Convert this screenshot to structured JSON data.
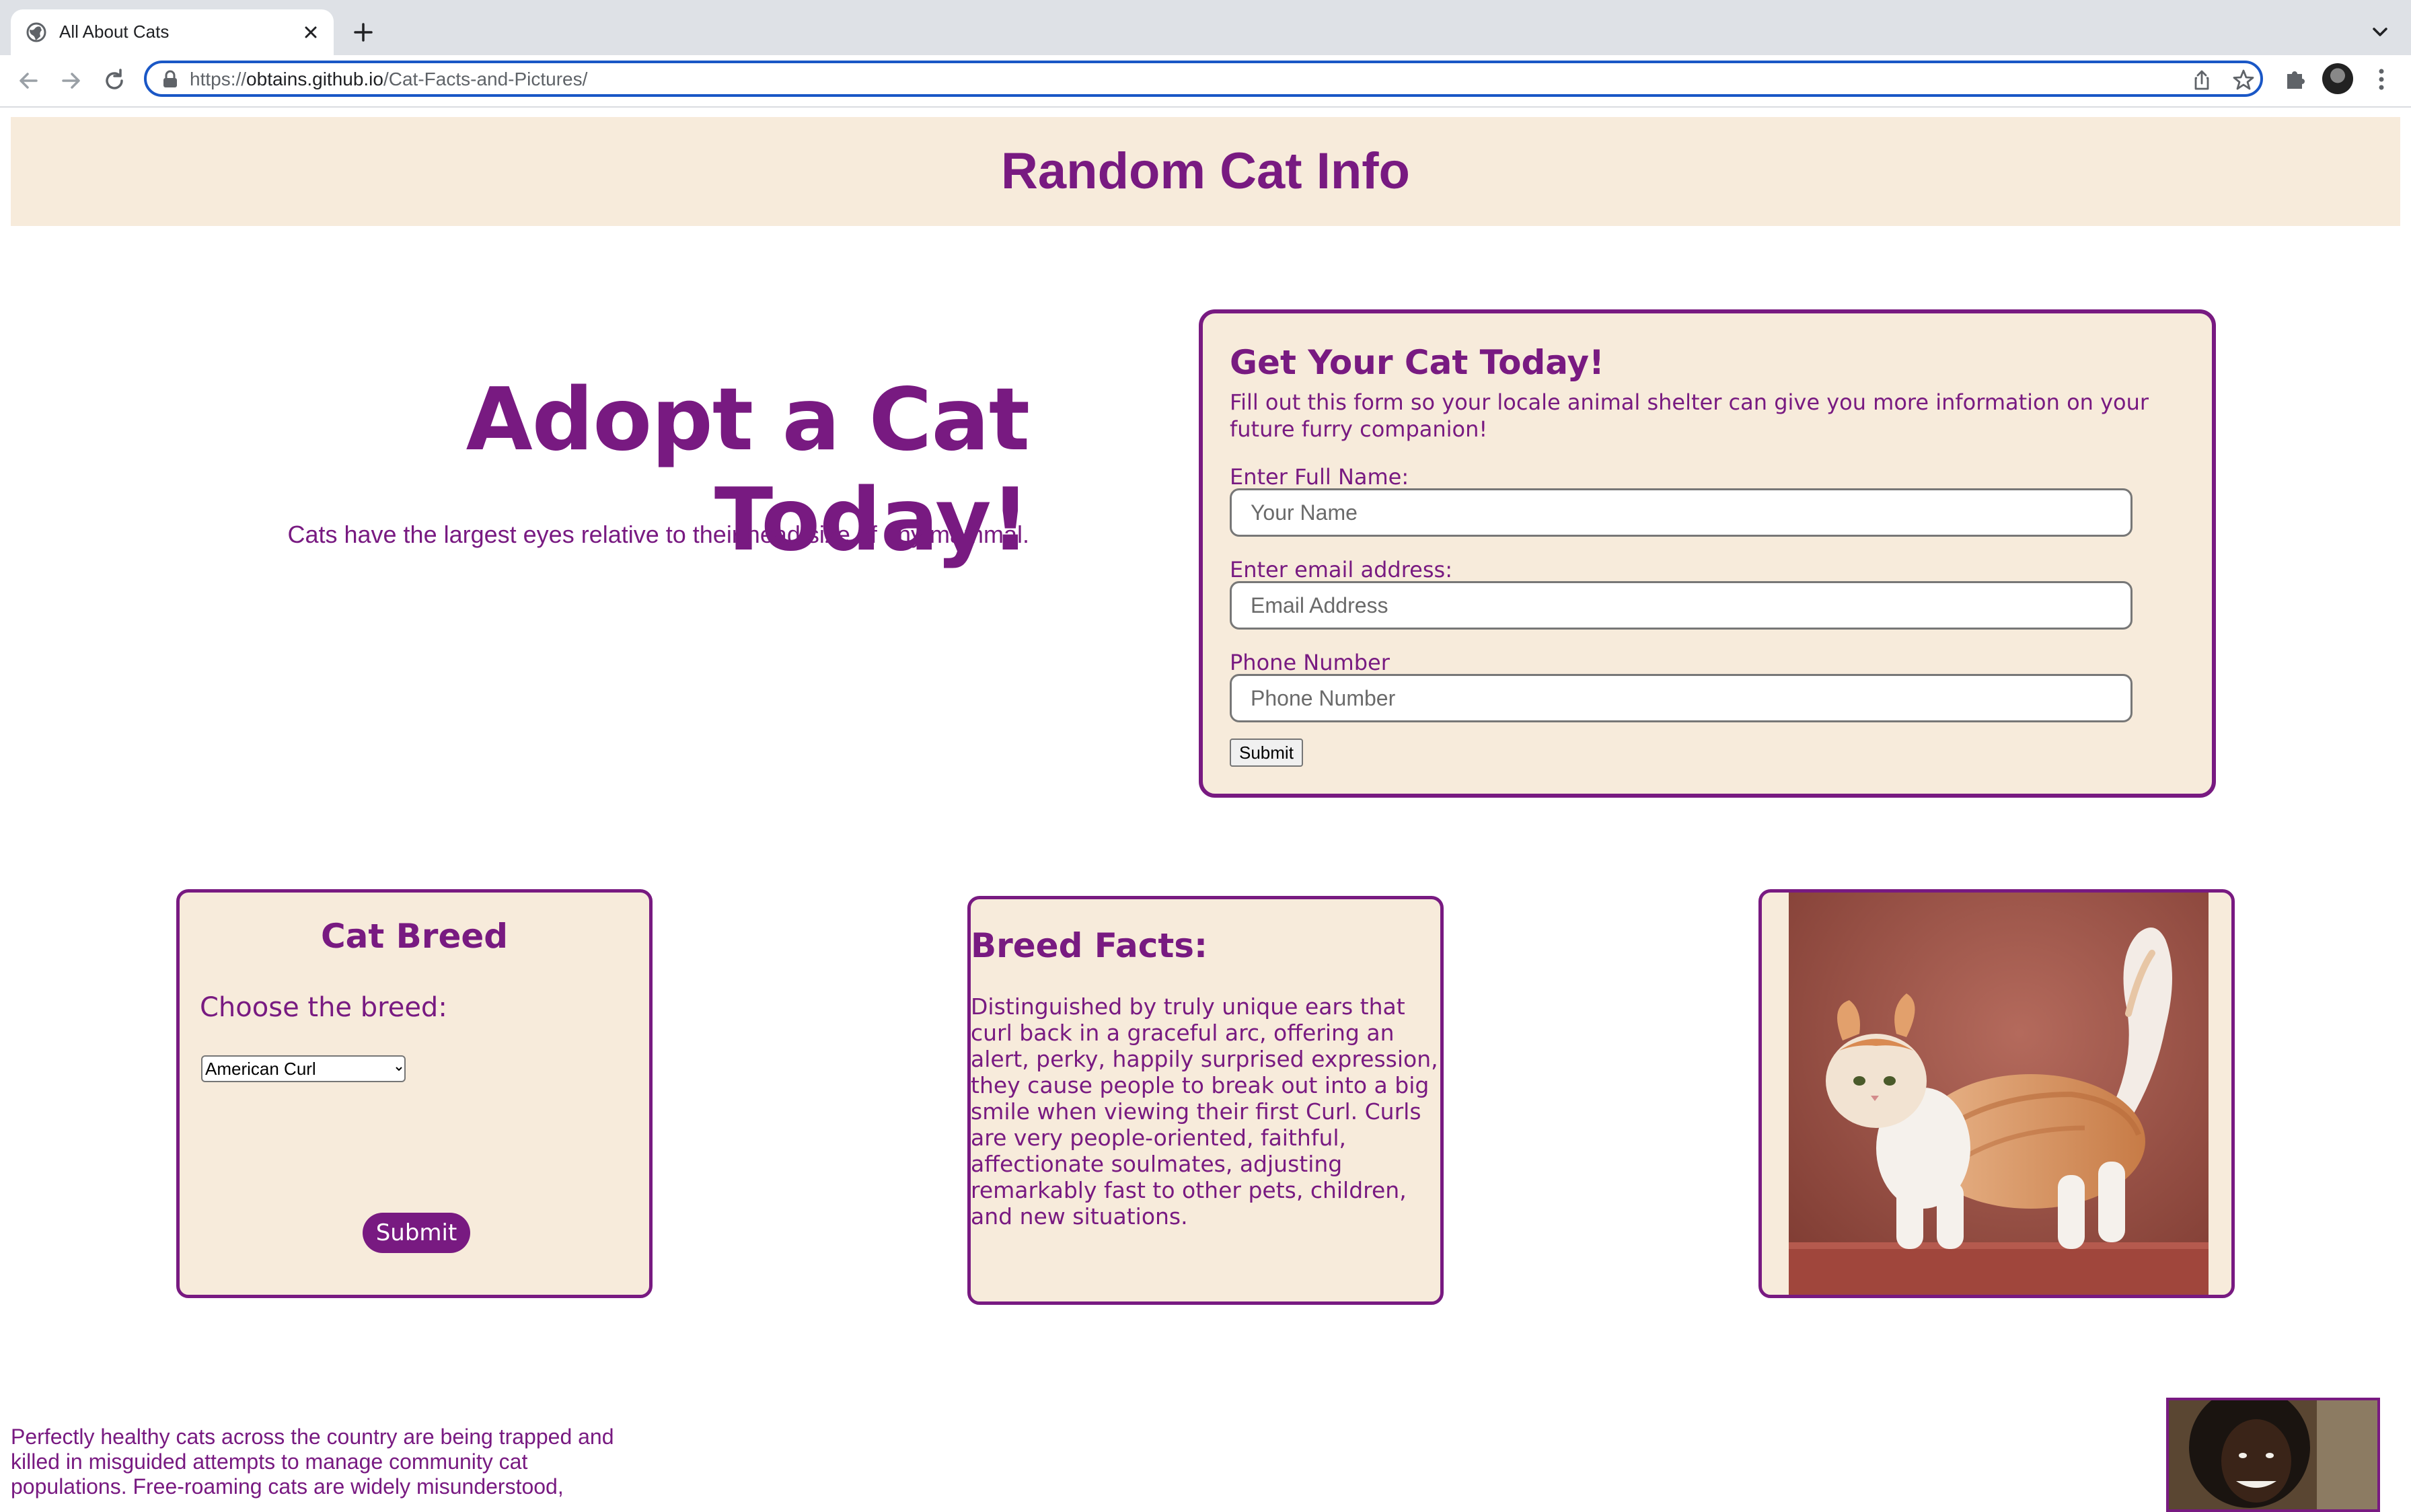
{
  "browser": {
    "tab_title": "All About Cats",
    "url_scheme": "https://",
    "url_host": "obtains.github.io",
    "url_path": "/Cat-Facts-and-Pictures/"
  },
  "header": {
    "title": "Random Cat Info"
  },
  "hero": {
    "title": "Adopt a Cat Today!",
    "fact": "Cats have the largest eyes relative to their head size of any mammal."
  },
  "adopt_form": {
    "title": "Get Your Cat Today!",
    "description": "Fill out this form so your locale animal shelter can give you more information on your future furry companion!",
    "name_label": "Enter Full Name:",
    "name_placeholder": "Your Name",
    "email_label": "Enter email address:",
    "email_placeholder": "Email Address",
    "phone_label": "Phone Number",
    "phone_placeholder": "Phone Number",
    "submit_label": "Submit"
  },
  "breed_picker": {
    "title": "Cat Breed",
    "prompt": "Choose the breed:",
    "selected": "American Curl",
    "submit_label": "Submit"
  },
  "breed_facts": {
    "title": "Breed Facts:",
    "text": "Distinguished by truly unique ears that curl back in a graceful arc, offering an alert, perky, happily surprised expression, they cause people to break out into a big smile when viewing their first Curl. Curls are very people-oriented, faithful, affectionate soulmates, adjusting remarkably fast to other pets, children, and new situations."
  },
  "footer": {
    "text": "Perfectly healthy cats across the country are being trapped and killed in misguided attempts to manage community cat populations. Free-roaming cats are widely misunderstood,"
  },
  "colors": {
    "accent": "#781a81",
    "card_bg": "#f7ebdb",
    "omnibox_focus": "#1a57c6"
  }
}
